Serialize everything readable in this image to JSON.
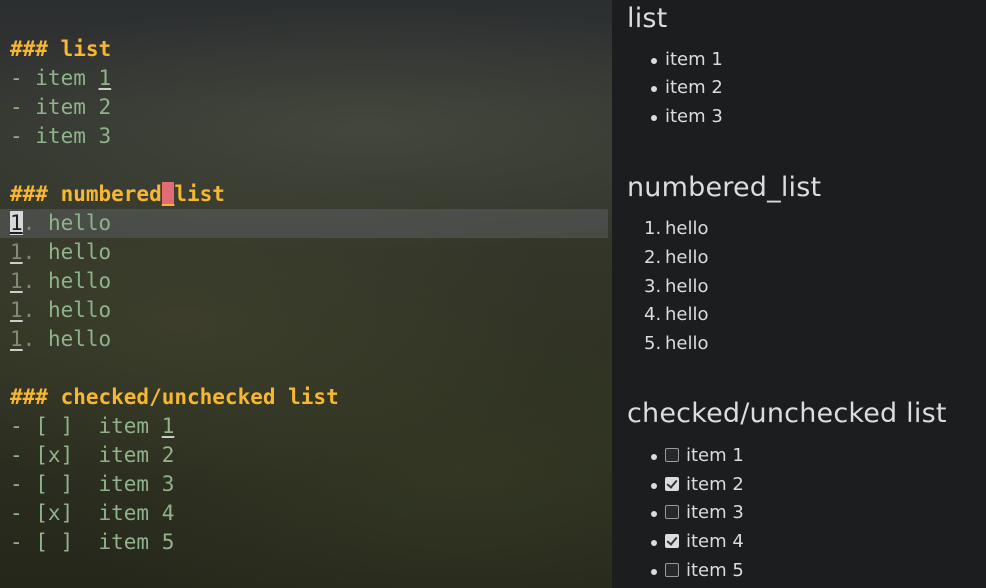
{
  "editor": {
    "heading_list": "### list",
    "list_items": [
      "- item 1",
      "- item 2",
      "- item 3"
    ],
    "heading_numbered": "### numbered_list",
    "numbered_items": [
      "1. hello",
      "1. hello",
      "1. hello",
      "1. hello",
      "1. hello"
    ],
    "heading_checked": "### checked/unchecked list",
    "checked_items": [
      "- [ ]  item 1",
      "- [x]  item 2",
      "- [ ]  item 3",
      "- [x]  item 4",
      "- [ ]  item 5"
    ]
  },
  "preview": {
    "list_title": "list",
    "list_items": [
      "item 1",
      "item 2",
      "item 3"
    ],
    "numbered_title": "numbered_list",
    "numbered_items": [
      {
        "num": "1.",
        "text": "hello"
      },
      {
        "num": "2.",
        "text": "hello"
      },
      {
        "num": "3.",
        "text": "hello"
      },
      {
        "num": "4.",
        "text": "hello"
      },
      {
        "num": "5.",
        "text": "hello"
      }
    ],
    "checked_title": "checked/unchecked list",
    "checked_items": [
      {
        "text": "item 1",
        "checked": false
      },
      {
        "text": "item 2",
        "checked": true
      },
      {
        "text": "item 3",
        "checked": false
      },
      {
        "text": "item 4",
        "checked": true
      },
      {
        "text": "item 5",
        "checked": false
      }
    ]
  }
}
